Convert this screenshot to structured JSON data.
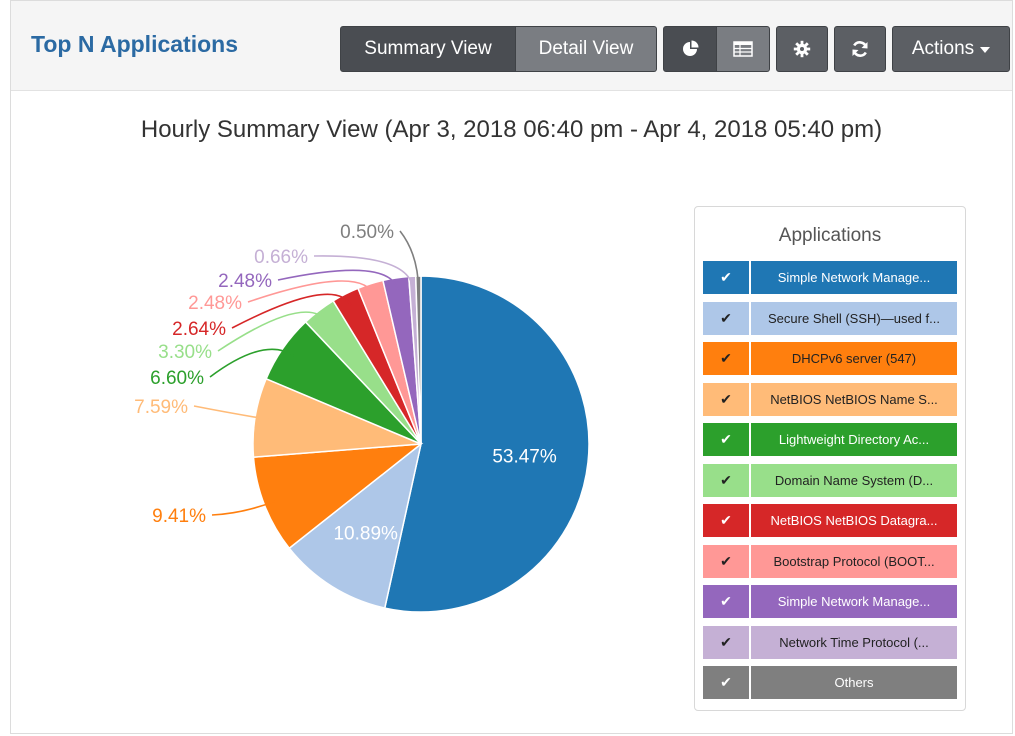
{
  "header": {
    "title": "Top N Applications",
    "summary_view_label": "Summary View",
    "detail_view_label": "Detail View",
    "pie_icon_name": "pie-chart-icon",
    "table_icon_name": "table-icon",
    "settings_icon_name": "gear-icon",
    "refresh_icon_name": "refresh-icon",
    "actions_label": "Actions"
  },
  "chart_data": {
    "type": "pie",
    "title": "Hourly Summary View (Apr 3, 2018 06:40 pm - Apr 4, 2018 05:40 pm)",
    "slices": [
      {
        "label": "Simple Network Manage...",
        "value": 53.47,
        "value_label": "53.47%",
        "color": "#1f77b4",
        "text_color": "#ffffff"
      },
      {
        "label": "Secure Shell (SSH)—used f...",
        "value": 10.89,
        "value_label": "10.89%",
        "color": "#aec7e8",
        "text_color": "#222222"
      },
      {
        "label": "DHCPv6 server (547)",
        "value": 9.41,
        "value_label": "9.41%",
        "color": "#ff7f0e",
        "text_color": "#222222"
      },
      {
        "label": "NetBIOS NetBIOS Name S...",
        "value": 7.59,
        "value_label": "7.59%",
        "color": "#ffbb78",
        "text_color": "#222222"
      },
      {
        "label": "Lightweight Directory Ac...",
        "value": 6.6,
        "value_label": "6.60%",
        "color": "#2ca02c",
        "text_color": "#ffffff"
      },
      {
        "label": "Domain Name System (D...",
        "value": 3.3,
        "value_label": "3.30%",
        "color": "#98df8a",
        "text_color": "#222222"
      },
      {
        "label": "NetBIOS NetBIOS Datagra...",
        "value": 2.64,
        "value_label": "2.64%",
        "color": "#d62728",
        "text_color": "#ffffff"
      },
      {
        "label": "Bootstrap Protocol (BOOT...",
        "value": 2.48,
        "value_label": "2.48%",
        "color": "#ff9896",
        "text_color": "#222222"
      },
      {
        "label": "Simple Network Manage...",
        "value": 2.48,
        "value_label": "2.48%",
        "color": "#9467bd",
        "text_color": "#ffffff"
      },
      {
        "label": "Network Time Protocol (...",
        "value": 0.66,
        "value_label": "0.66%",
        "color": "#c5b0d5",
        "text_color": "#222222"
      },
      {
        "label": "Others",
        "value": 0.5,
        "value_label": "0.50%",
        "color": "#7f7f7f",
        "text_color": "#ffffff"
      }
    ]
  },
  "legend": {
    "title": "Applications",
    "check_symbol": "✔"
  }
}
